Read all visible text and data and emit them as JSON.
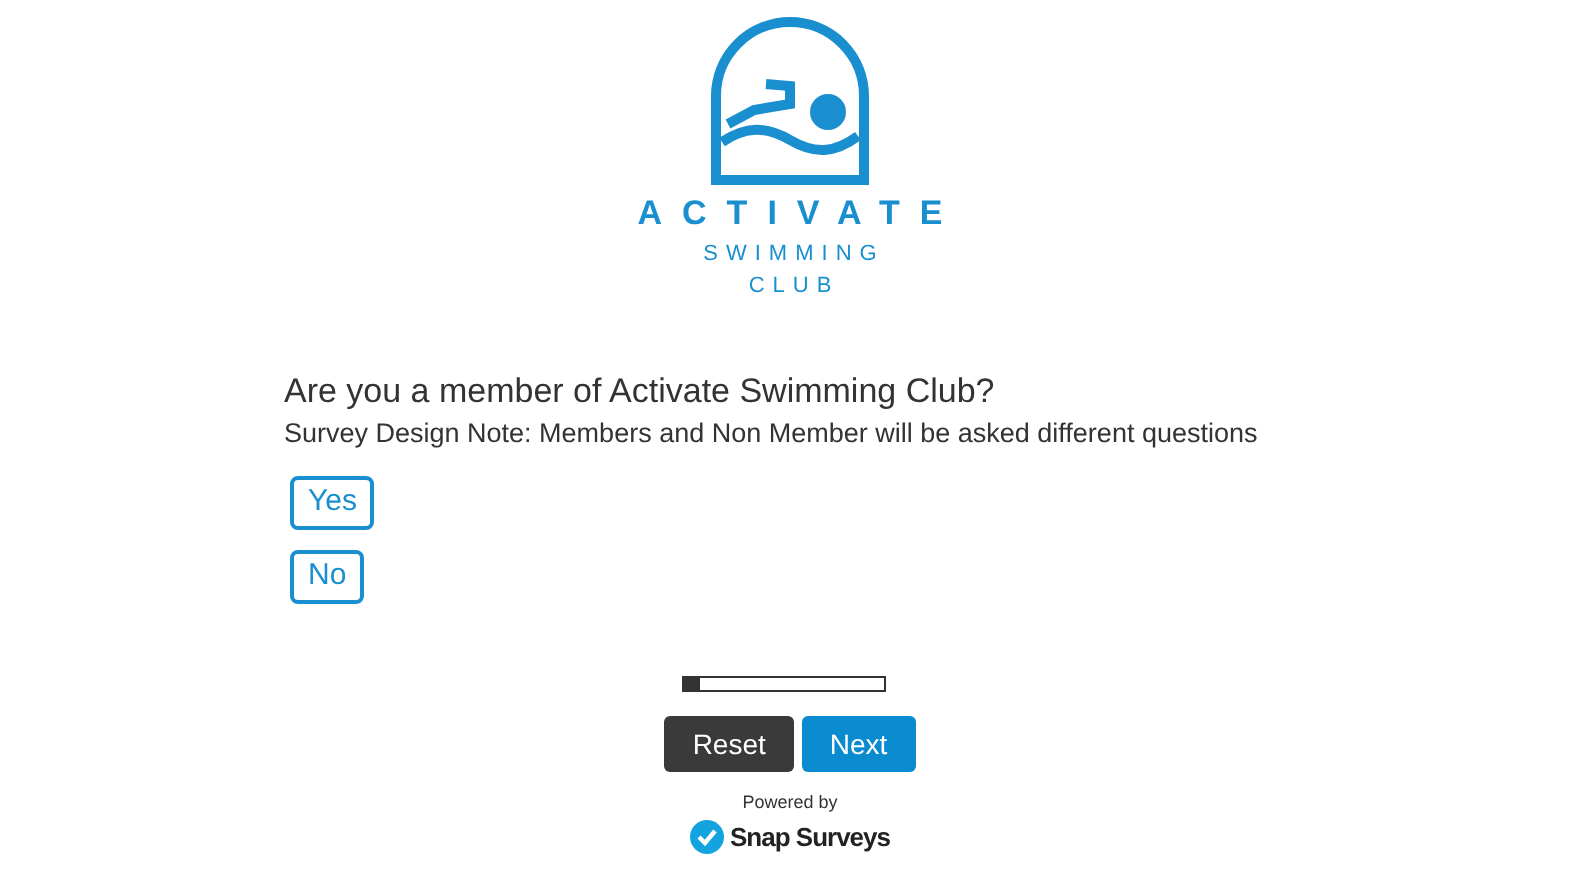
{
  "logo": {
    "name": "ACTIVATE",
    "subtitle_line_1": "SWIMMING",
    "subtitle_line_2": "CLUB"
  },
  "question": {
    "title": "Are you a member of Activate Swimming Club?",
    "note": "Survey Design Note: Members and Non Member will be asked different questions",
    "options": [
      {
        "label": "Yes",
        "selected": false
      },
      {
        "label": "No",
        "selected": false
      }
    ]
  },
  "progress": {
    "level": 0.08
  },
  "buttons": [
    {
      "label": "Reset",
      "kind": "secondary"
    },
    {
      "label": "Next",
      "kind": "primary"
    }
  ],
  "footer": {
    "powered_by": "Powered by",
    "brand": "Snap Surveys"
  }
}
